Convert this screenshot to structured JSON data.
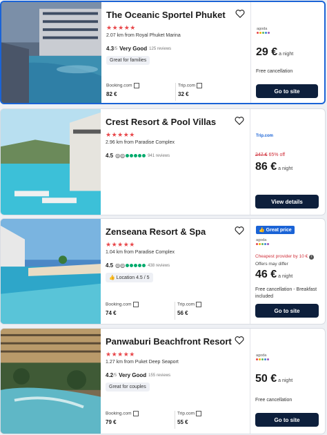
{
  "hotels": [
    {
      "name": "The Oceanic Sportel Phuket",
      "stars": "★★★★★",
      "distance": "2.07 km from Royal Phuket Marina",
      "score": "4.3",
      "score_max": "/5",
      "score_label": "Very Good",
      "reviews": "125 reviews",
      "tag": "Great for families",
      "providers": [
        {
          "name": "Booking.com",
          "price": "82 €"
        },
        {
          "name": "Trip.com",
          "price": "32 €"
        }
      ],
      "deal_provider": "agoda",
      "price": "29 €",
      "per": "a night",
      "notes": "Free cancellation",
      "button": "Go to site"
    },
    {
      "name": "Crest Resort & Pool Villas",
      "stars": "★★★★★",
      "distance": "2.96 km from Paradise Complex",
      "score": "4.5",
      "reviews": "941 reviews",
      "deal_provider": "Trip.com",
      "old_price": "247 €",
      "discount": "65% off",
      "price": "86 €",
      "per": "a night",
      "button": "View details"
    },
    {
      "name": "Zenseana Resort & Spa",
      "stars": "★★★★★",
      "distance": "1.04 km from Paradise Complex",
      "score": "4.5",
      "reviews": "438 reviews",
      "location_badge": "Location 4.5 / 5",
      "providers": [
        {
          "name": "Booking.com",
          "price": "74 €"
        },
        {
          "name": "Trip.com",
          "price": "56 €"
        }
      ],
      "great_price": "Great price",
      "deal_provider": "agoda",
      "cheapest_note": "Cheapest provider by 10 €",
      "offers_note": "Offers may differ",
      "price": "46 €",
      "per": "a night",
      "notes": "Free cancellation - Breakfast included",
      "button": "Go to site"
    },
    {
      "name": "Panwaburi Beachfront Resort",
      "stars": "★★★★★",
      "distance": "1.27 km from Puket Deep Seaport",
      "score": "4.2",
      "score_max": "/5",
      "score_label": "Very Good",
      "reviews": "155 reviews",
      "tag": "Great for couples",
      "providers": [
        {
          "name": "Booking.com",
          "price": "79 €"
        },
        {
          "name": "Trip.com",
          "price": "55 €"
        }
      ],
      "deal_provider": "agoda",
      "price": "50 €",
      "per": "a night",
      "notes": "Free cancellation",
      "button": "Go to site"
    }
  ],
  "colors": {
    "accent": "#1a63d6",
    "button": "#0d1f3c",
    "stars": "#e8474a",
    "strike": "#d0303a"
  },
  "icons": [
    "heart-outline-icon",
    "external-link-icon",
    "thumbs-up-icon",
    "info-icon",
    "tripadvisor-icon"
  ]
}
